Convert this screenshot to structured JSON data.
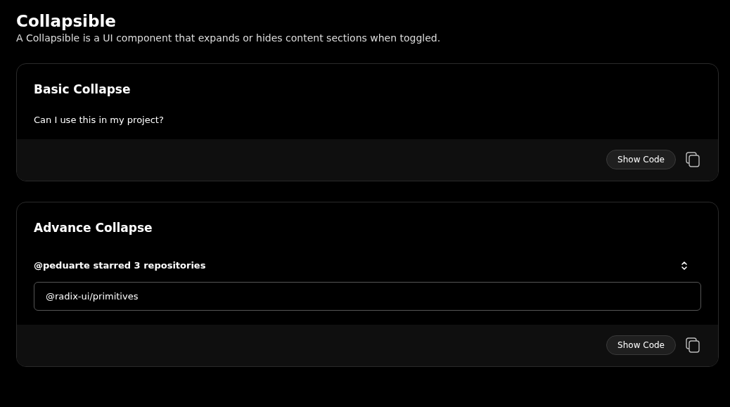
{
  "header": {
    "title": "Collapsible",
    "description": "A Collapsible is a UI component that expands or hides content sections when toggled."
  },
  "cards": [
    {
      "kind": "basic",
      "title": "Basic Collapse",
      "question": "Can I use this in my project?",
      "button": "Show Code"
    },
    {
      "kind": "advanced",
      "title": "Advance Collapse",
      "trigger": "@peduarte starred 3 repositories",
      "items": [
        "@radix-ui/primitives"
      ],
      "button": "Show Code"
    }
  ]
}
